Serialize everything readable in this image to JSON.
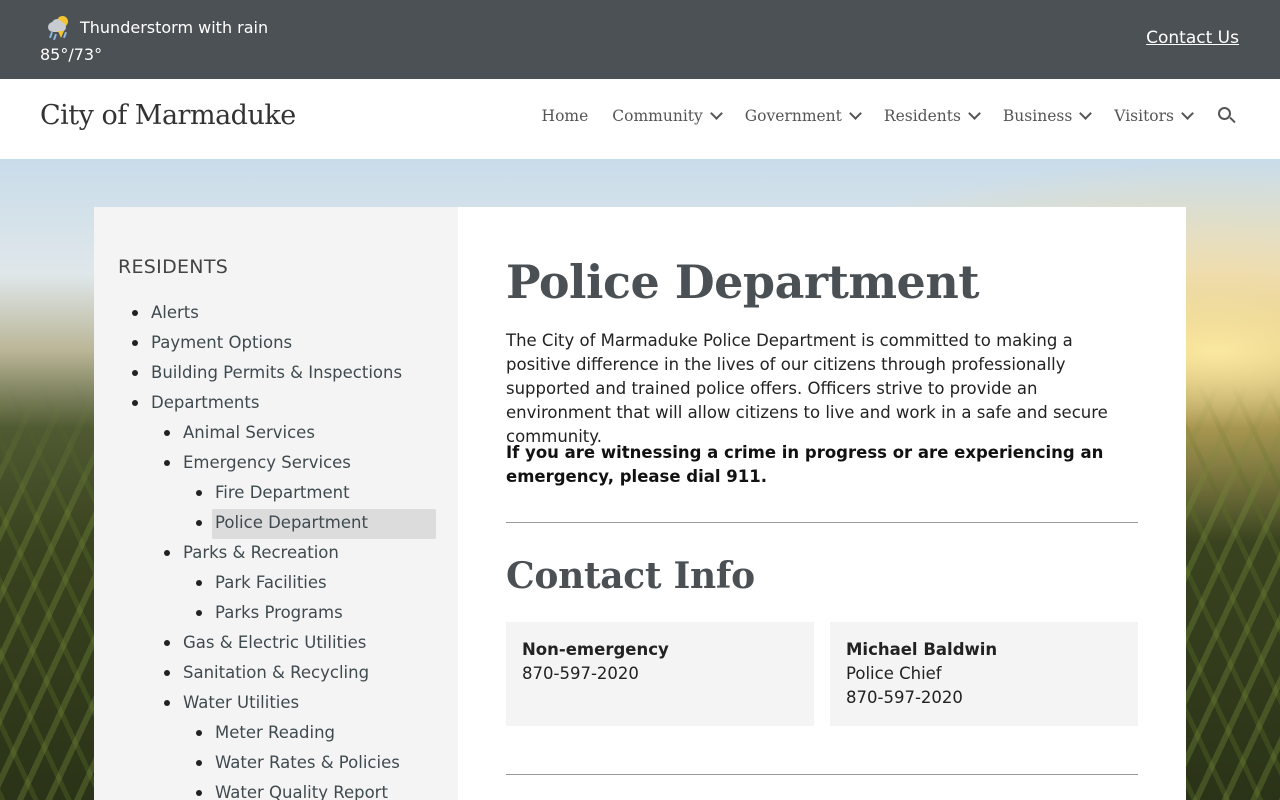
{
  "topbar": {
    "weather_icon": "thunderstorm-rain-icon",
    "weather_condition": "Thunderstorm with rain",
    "weather_temps": "85°/73°",
    "contact_link": "Contact Us"
  },
  "header": {
    "site_title": "City of Marmaduke",
    "nav": [
      {
        "label": "Home",
        "dropdown": false
      },
      {
        "label": "Community",
        "dropdown": true
      },
      {
        "label": "Government",
        "dropdown": true
      },
      {
        "label": "Residents",
        "dropdown": true
      },
      {
        "label": "Business",
        "dropdown": true
      },
      {
        "label": "Visitors",
        "dropdown": true
      }
    ],
    "search_icon": "search-icon"
  },
  "sidebar": {
    "heading": "RESIDENTS",
    "items": [
      {
        "label": "Alerts",
        "level": 1
      },
      {
        "label": "Payment Options",
        "level": 1
      },
      {
        "label": "Building Permits & Inspections",
        "level": 1
      },
      {
        "label": "Departments",
        "level": 1
      },
      {
        "label": "Animal Services",
        "level": 2
      },
      {
        "label": "Emergency Services",
        "level": 2
      },
      {
        "label": "Fire Department",
        "level": 3
      },
      {
        "label": "Police Department",
        "level": 3,
        "active": true
      },
      {
        "label": "Parks & Recreation",
        "level": 2
      },
      {
        "label": "Park Facilities",
        "level": 3
      },
      {
        "label": "Parks Programs",
        "level": 3
      },
      {
        "label": "Gas & Electric Utilities",
        "level": 2
      },
      {
        "label": "Sanitation & Recycling",
        "level": 2
      },
      {
        "label": "Water Utilities",
        "level": 2
      },
      {
        "label": "Meter Reading",
        "level": 3
      },
      {
        "label": "Water Rates & Policies",
        "level": 3
      },
      {
        "label": "Water Quality Report",
        "level": 3
      }
    ]
  },
  "main": {
    "title": "Police Department",
    "intro": "The City of Marmaduke Police Department is committed to making a positive difference in the lives of our citizens through professionally supported and trained police offers. Officers strive to provide an environment that will allow citizens to live and work in a safe and secure community.",
    "emergency_note": "If you are witnessing a crime in progress or are experiencing an emergency, please dial 911.",
    "contact_heading": "Contact Info",
    "contacts": [
      {
        "name": "Non-emergency",
        "role": "",
        "phone": "870-597-2020"
      },
      {
        "name": "Michael Baldwin",
        "role": "Police Chief",
        "phone": "870-597-2020"
      }
    ]
  },
  "colors": {
    "topbar_bg": "#4b5154",
    "sidebar_bg": "#f4f4f4",
    "active_item_bg": "#dcdcdc",
    "heading_text": "#4a5054"
  }
}
